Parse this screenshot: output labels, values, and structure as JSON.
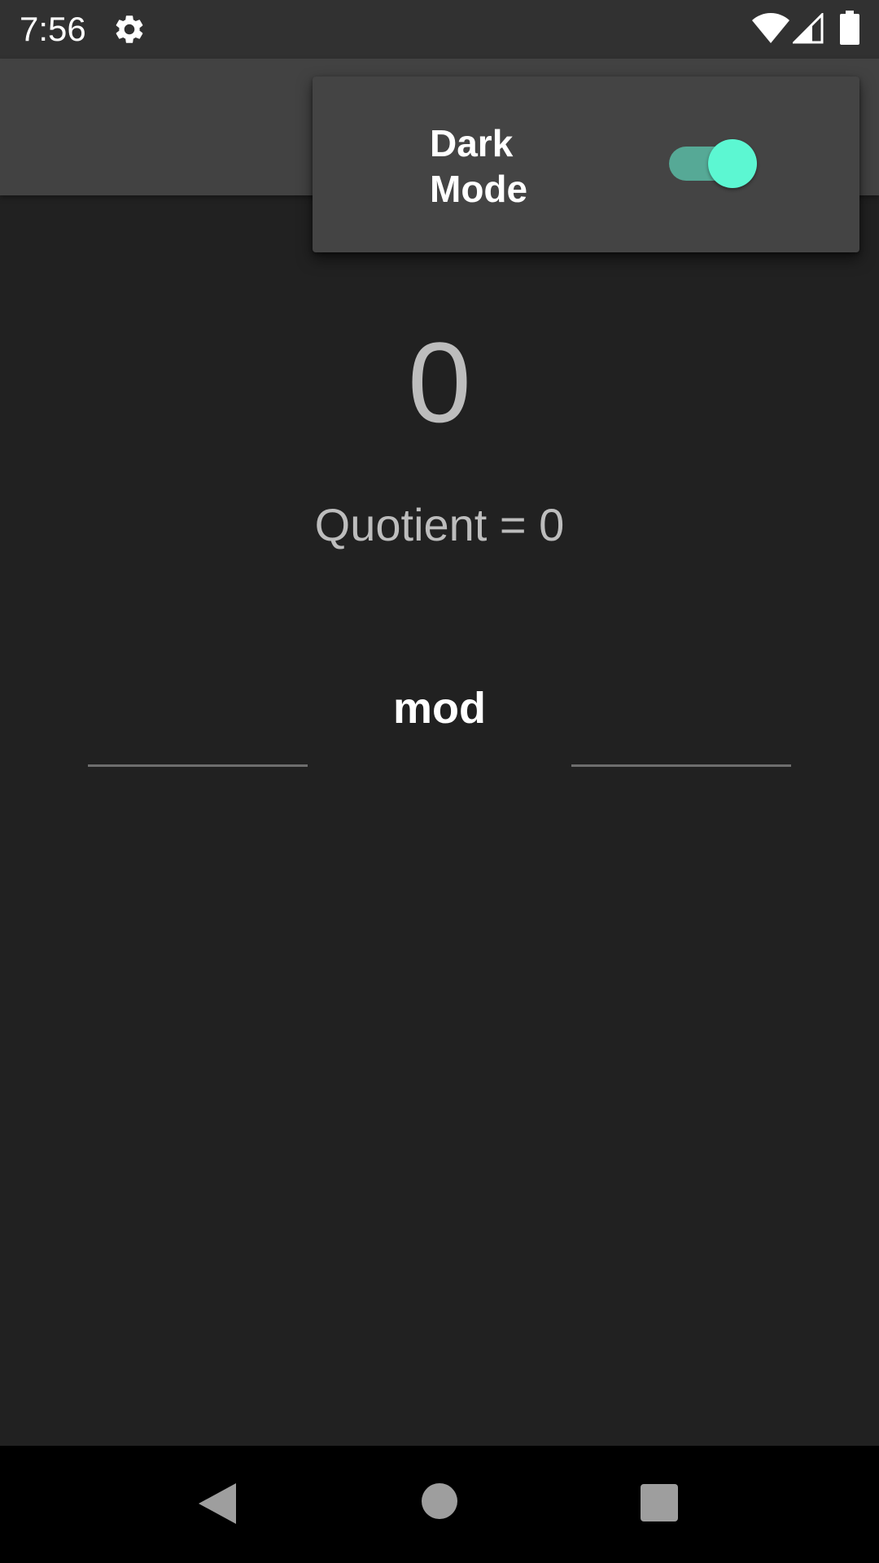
{
  "status_bar": {
    "time": "7:56",
    "icons": [
      "gear-icon",
      "wifi-icon",
      "cell-signal-icon",
      "battery-icon"
    ]
  },
  "menu": {
    "dark_mode_label": "Dark\nMode",
    "dark_mode_enabled": true
  },
  "main": {
    "result": "0",
    "quotient_text": "Quotient = 0",
    "operator_label": "mod",
    "first_number_value": "",
    "second_number_value": ""
  },
  "nav_bar": {
    "icons": [
      "back-icon",
      "home-icon",
      "recents-icon"
    ]
  },
  "colors": {
    "background": "#212121",
    "app_bar": "#424242",
    "status_bar": "#313131",
    "menu_background": "#444444",
    "switch_thumb": "#5cf7d2",
    "switch_track": "#56a996",
    "result_text": "#bdbdbd"
  }
}
